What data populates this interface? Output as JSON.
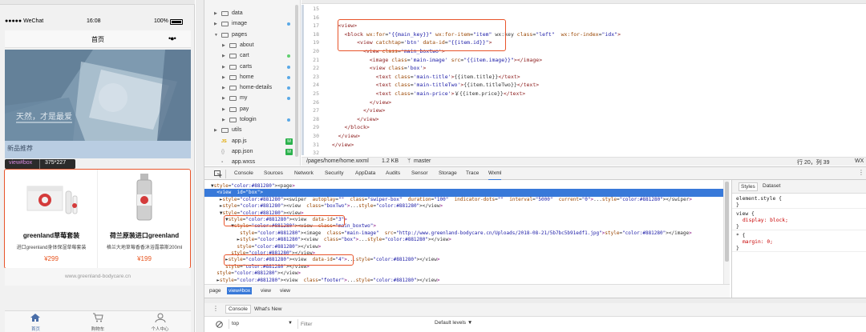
{
  "simulator": {
    "status": {
      "carrier": "●●●●● WeChat",
      "time": "16:08",
      "battery": "100%"
    },
    "nav": {
      "title": "首页",
      "menu": "•●•"
    },
    "hero": {
      "overlay_text": "天然，才是最爱"
    },
    "section_title": "新品推荐",
    "inspect_tooltip": {
      "selector": "view#box",
      "size": "375*227"
    },
    "cards": [
      {
        "name": "greenland草莓套装",
        "desc": "进口greenland身体保湿草莓套装",
        "price": "¥299"
      },
      {
        "name": "荷兰原装进口greenland",
        "desc": "格兰大地草莓香香沐浴露慕斯200ml",
        "price": "¥199"
      }
    ],
    "footer_link": "www.greenland-bodycare.cn",
    "tabbar": [
      {
        "label": "首页",
        "icon": "home-icon",
        "active": true
      },
      {
        "label": "购物车",
        "icon": "cart-icon",
        "active": false
      },
      {
        "label": "个人中心",
        "icon": "user-icon",
        "active": false
      }
    ],
    "accent": "#4a6ea8",
    "price_color": "#e8541e"
  },
  "file_tree": [
    {
      "label": "data",
      "type": "folder",
      "expanded": false,
      "depth": 0,
      "status": ""
    },
    {
      "label": "image",
      "type": "folder",
      "expanded": false,
      "depth": 0,
      "status": "blue"
    },
    {
      "label": "pages",
      "type": "folder",
      "expanded": true,
      "depth": 0,
      "status": ""
    },
    {
      "label": "about",
      "type": "folder",
      "expanded": false,
      "depth": 1,
      "status": ""
    },
    {
      "label": "cart",
      "type": "folder",
      "expanded": false,
      "depth": 1,
      "status": "green"
    },
    {
      "label": "carts",
      "type": "folder",
      "expanded": false,
      "depth": 1,
      "status": "blue"
    },
    {
      "label": "home",
      "type": "folder",
      "expanded": false,
      "depth": 1,
      "status": "blue"
    },
    {
      "label": "home-details",
      "type": "folder",
      "expanded": false,
      "depth": 1,
      "status": "blue"
    },
    {
      "label": "my",
      "type": "folder",
      "expanded": false,
      "depth": 1,
      "status": "blue"
    },
    {
      "label": "pay",
      "type": "folder",
      "expanded": false,
      "depth": 1,
      "status": ""
    },
    {
      "label": "tologin",
      "type": "folder",
      "expanded": false,
      "depth": 1,
      "status": "blue"
    },
    {
      "label": "utils",
      "type": "folder",
      "expanded": false,
      "depth": 0,
      "status": ""
    },
    {
      "label": "app.js",
      "type": "js",
      "expanded": false,
      "depth": 0,
      "status": "M"
    },
    {
      "label": "app.json",
      "type": "json",
      "expanded": false,
      "depth": 0,
      "status": "M"
    },
    {
      "label": "app.wxss",
      "type": "file",
      "expanded": false,
      "depth": 0,
      "status": ""
    }
  ],
  "editor": {
    "lines": [
      {
        "n": "15",
        "code": ""
      },
      {
        "n": "16",
        "code": ""
      },
      {
        "n": "17",
        "code": "    <view>"
      },
      {
        "n": "18",
        "code": "      <block wx:for=\"{{main_key}}\" wx:for-item=\"item\" wx:key class=\"left\"  wx:for-index=\"idx\">"
      },
      {
        "n": "19",
        "code": "          <view catchtap='btn' data-id=\"{{item.id}}\">"
      },
      {
        "n": "20",
        "code": "            <view class='main_boxtwo'>"
      },
      {
        "n": "21",
        "code": "              <image class='main-image' src=\"{{item.image}}\"></image>"
      },
      {
        "n": "22",
        "code": "              <view class='box'>"
      },
      {
        "n": "23",
        "code": "                <text class='main-title'>{{item.title}}</text>"
      },
      {
        "n": "24",
        "code": "                <text class='main-titleTwo'>{{item.titleTwo}}</text>"
      },
      {
        "n": "25",
        "code": "                <text class='main-price'>￥{{item.price}}</text>"
      },
      {
        "n": "26",
        "code": "              </view>"
      },
      {
        "n": "27",
        "code": "            </view>"
      },
      {
        "n": "28",
        "code": "          </view>"
      },
      {
        "n": "29",
        "code": "      </block>"
      },
      {
        "n": "30",
        "code": "    </view>"
      },
      {
        "n": "31",
        "code": "  </view>"
      },
      {
        "n": "32",
        "code": ""
      }
    ],
    "status": {
      "path": "/pages/home/home.wxml",
      "size": "1.2 KB",
      "branch": "master",
      "position": "行 20，列 39",
      "lang": "WX"
    }
  },
  "devtools": {
    "tabs": [
      "Console",
      "Sources",
      "Network",
      "Security",
      "AppData",
      "Audits",
      "Sensor",
      "Storage",
      "Trace",
      "Wxml"
    ],
    "active_tab": "Wxml",
    "dom_lines": [
      {
        "text": "▼<page>",
        "indent": 0,
        "selected": false
      },
      {
        "text": "  <view  id=\"box\">",
        "indent": 1,
        "selected": true
      },
      {
        "text": "   ►<swiper  autoplay=\"\"  class=\"swiper-box\"  duration=\"100\"  indicator-dots=\"\"  interval=\"5000\"  current=\"0\">...</swiper>",
        "indent": 1,
        "selected": false
      },
      {
        "text": "   ►<view  class=\"boxTwo\">...</view>",
        "indent": 1,
        "selected": false
      },
      {
        "text": "   ▼<view>",
        "indent": 1,
        "selected": false
      },
      {
        "text": "     ▼<view  data-id=\"3\">",
        "indent": 2,
        "selected": false
      },
      {
        "text": "       ▼<view  class=\"main_boxtwo\">",
        "indent": 3,
        "selected": false
      },
      {
        "text": "          <image  class=\"main-image\"  src=\"http://www.greenland-bodycare.cn/Uploads/2018-08-21/5b7bc5b91edf1.jpg\"></image>",
        "indent": 4,
        "selected": false
      },
      {
        "text": "         ►<view  class=\"box\">...</view>",
        "indent": 4,
        "selected": false
      },
      {
        "text": "         </view>",
        "indent": 3,
        "selected": false
      },
      {
        "text": "       </view>",
        "indent": 2,
        "selected": false
      },
      {
        "text": "     ►<view  data-id=\"4\">...</view>",
        "indent": 2,
        "selected": false
      },
      {
        "text": "     </view>",
        "indent": 1,
        "selected": false
      },
      {
        "text": "  </view>",
        "indent": 1,
        "selected": false
      },
      {
        "text": "  ►<view  class=\"footer\">...</view>",
        "indent": 1,
        "selected": false
      }
    ],
    "breadcrumb": [
      "page",
      "view#box",
      "view",
      "view"
    ],
    "styles_tabs": [
      "Styles",
      "Dataset"
    ],
    "styles": [
      {
        "selector": "element.style {",
        "props": [],
        "close": "}"
      },
      {
        "selector": "view {",
        "props": [
          "display: block;"
        ],
        "close": "}"
      },
      {
        "selector": "* {",
        "props": [
          "margin: 0;"
        ],
        "close": "}"
      }
    ]
  },
  "console": {
    "tabs": [
      "Console",
      "What's New"
    ],
    "context": "top",
    "filter_placeholder": "Filter",
    "levels": "Default levels ▼"
  }
}
